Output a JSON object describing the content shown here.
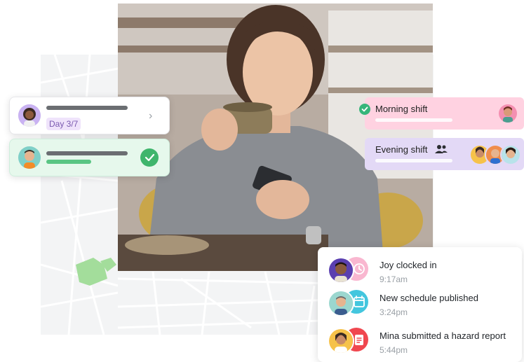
{
  "left_cards": {
    "day_card": {
      "badge": "Day 3/7"
    }
  },
  "shifts": [
    {
      "label": "Morning shift",
      "color": "#ffd2e1"
    },
    {
      "label": "Evening shift",
      "color": "#e3d9f6"
    }
  ],
  "feed": [
    {
      "title": "Joy clocked in",
      "time": "9:17am",
      "badge_color": "#f9b7d0",
      "badge_icon": "clock-icon"
    },
    {
      "title": "New schedule published",
      "time": "3:24pm",
      "badge_color": "#43c6de",
      "badge_icon": "calendar-icon"
    },
    {
      "title": "Mina submitted a hazard report",
      "time": "5:44pm",
      "badge_color": "#f0474f",
      "badge_icon": "report-icon"
    }
  ],
  "colors": {
    "success": "#3fb56c",
    "map_background": "#f3f4f5",
    "day_pill": "#efe3fb"
  }
}
